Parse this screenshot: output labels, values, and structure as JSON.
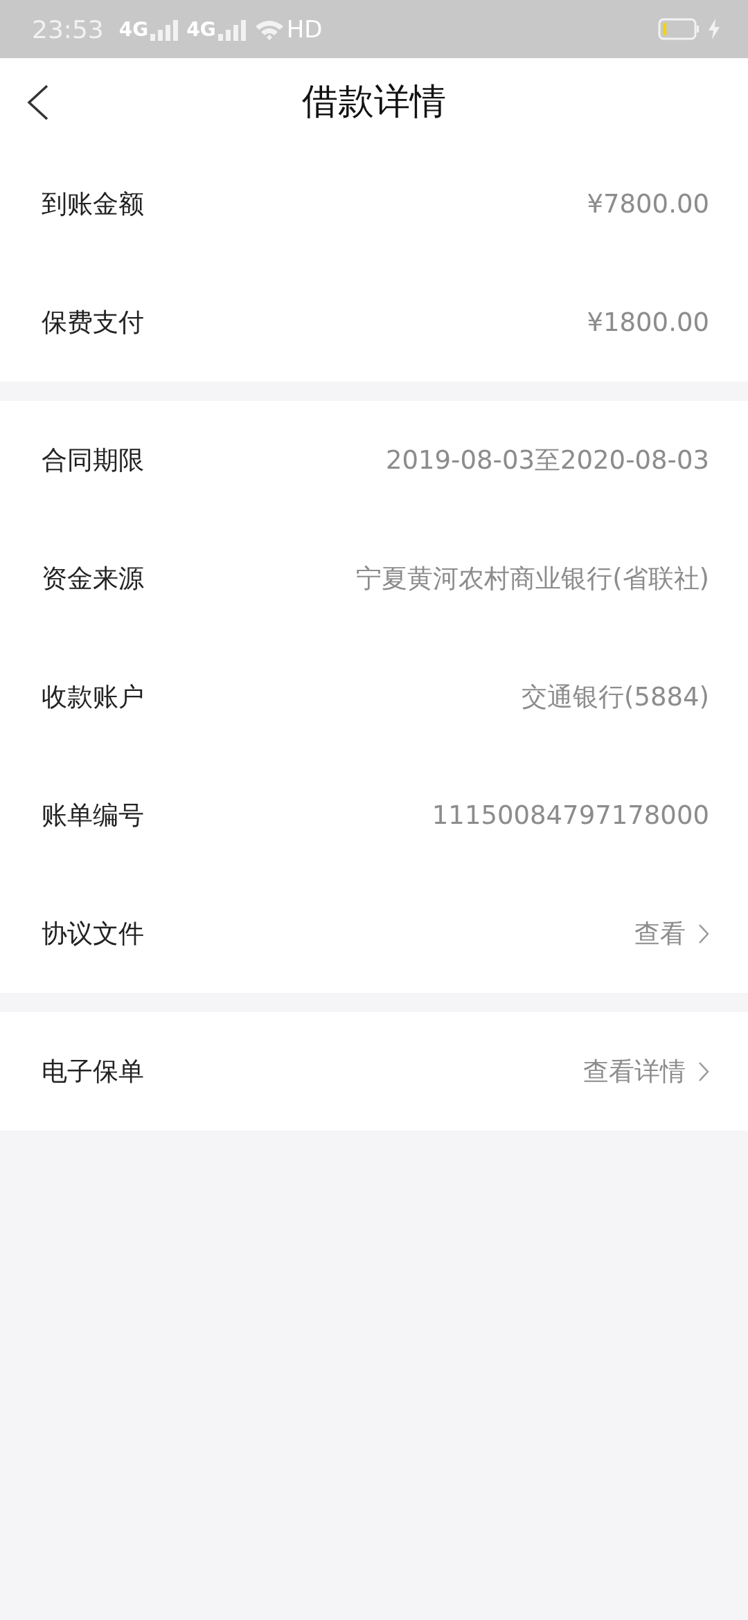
{
  "status_bar": {
    "time": "23:53",
    "networks": [
      "4G",
      "4G",
      "HD"
    ]
  },
  "nav": {
    "title": "借款详情"
  },
  "sections": [
    {
      "rows": [
        {
          "kind": "value",
          "label": "到账金额",
          "value": "¥7800.00"
        },
        {
          "kind": "value",
          "label": "保费支付",
          "value": "¥1800.00"
        }
      ]
    },
    {
      "rows": [
        {
          "kind": "value",
          "label": "合同期限",
          "value": "2019-08-03至2020-08-03"
        },
        {
          "kind": "value",
          "label": "资金来源",
          "value": "宁夏黄河农村商业银行(省联社)"
        },
        {
          "kind": "value",
          "label": "收款账户",
          "value": "交通银行(5884)"
        },
        {
          "kind": "value",
          "label": "账单编号",
          "value": "11150084797178000"
        },
        {
          "kind": "link",
          "label": "协议文件",
          "value": "查看"
        }
      ]
    },
    {
      "rows": [
        {
          "kind": "link",
          "label": "电子保单",
          "value": "查看详情"
        }
      ]
    }
  ]
}
